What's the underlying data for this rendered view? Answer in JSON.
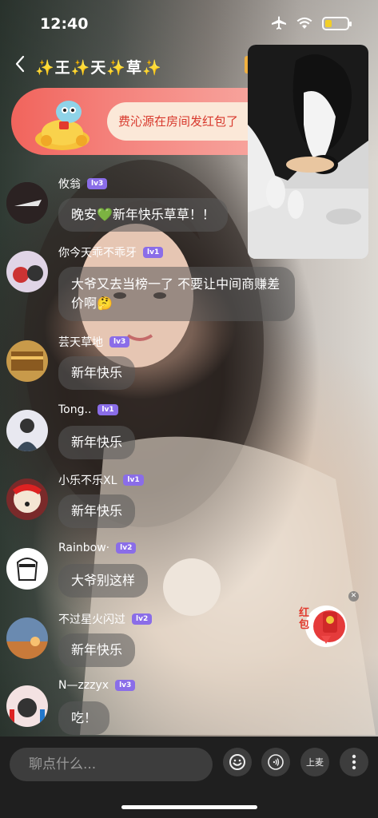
{
  "status": {
    "time": "12:40",
    "icons": [
      "airplane-icon",
      "wifi-icon",
      "battery-icon"
    ],
    "battery_level": 0.3,
    "battery_color": "#f5d020"
  },
  "header": {
    "title": "✨王✨天✨草✨"
  },
  "banner": {
    "message": "费沁源在房间发红包了",
    "colors": {
      "start": "#f1645c",
      "end": "#f7a39c",
      "text": "#d8382c"
    }
  },
  "messages": [
    {
      "user": "攸翁",
      "level": "lv3",
      "text": "晚安💚新年快乐草草！！"
    },
    {
      "user": "你今天乖不乖牙",
      "level": "lv1",
      "text": "大爷又去当榜一了 不要让中间商赚差价啊🤔"
    },
    {
      "user": "芸天草地",
      "level": "lv3",
      "text": "新年快乐"
    },
    {
      "user": "Tong..",
      "level": "lv1",
      "text": "新年快乐"
    },
    {
      "user": "小乐不乐XL",
      "level": "lv1",
      "text": "新年快乐"
    },
    {
      "user": "Rainbow·",
      "level": "lv2",
      "text": "大爷别这样"
    },
    {
      "user": "不过星火闪过",
      "level": "lv2",
      "text": "新年快乐"
    },
    {
      "user": "N—zzzyx",
      "level": "lv3",
      "text": "吃！"
    }
  ],
  "gift": {
    "label": "红包"
  },
  "bottom_bar": {
    "input_placeholder": "聊点什么...",
    "mic_label": "上麦",
    "buttons": [
      "emoji-icon",
      "voice-icon",
      "mic-button",
      "more-icon"
    ]
  }
}
